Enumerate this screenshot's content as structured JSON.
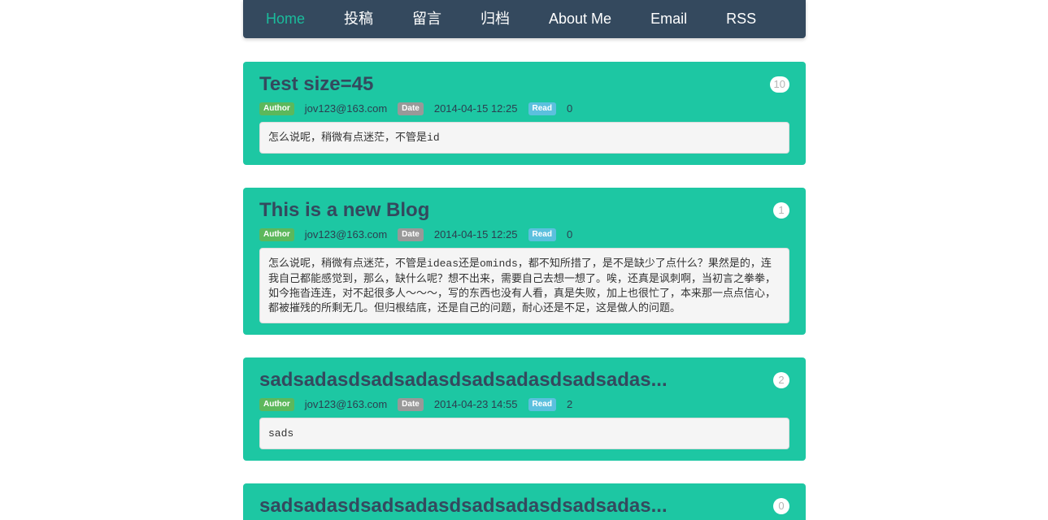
{
  "nav": {
    "items": [
      {
        "label": "Home",
        "active": true
      },
      {
        "label": "投稿"
      },
      {
        "label": "留言"
      },
      {
        "label": "归档"
      },
      {
        "label": "About Me"
      },
      {
        "label": "Email"
      },
      {
        "label": "RSS"
      }
    ]
  },
  "labels": {
    "author": "Author",
    "date": "Date",
    "read": "Read"
  },
  "posts": [
    {
      "title": "Test size=45",
      "comments": "10",
      "author": "jov123@163.com",
      "date": "2014-04-15 12:25",
      "read": "0",
      "content": [
        {
          "text": "怎么说呢，稍微有点迷茫，不管是"
        },
        {
          "code": "id"
        }
      ]
    },
    {
      "title": "This is a new Blog",
      "comments": "1",
      "author": "jov123@163.com",
      "date": "2014-04-15 12:25",
      "read": "0",
      "content": [
        {
          "text": "怎么说呢，稍微有点迷茫，不管是"
        },
        {
          "code": "ideas"
        },
        {
          "text": "还是"
        },
        {
          "code": "ominds"
        },
        {
          "text": "，都不知所措了，是不是缺少了点什么？果然是的，连我自己都能感觉到，那么，缺什么呢？想不出来，需要自己去想一想了。唉，还真是讽刺啊，当初言之拳拳，如今拖沓连连，对不起很多人～～～，写的东西也没有人看，真是失败，加上也很忙了，本来那一点点信心，都被摧残的所剩无几。但归根结底，还是自己的问题，耐心还是不足，这是做人的问题。"
        }
      ]
    },
    {
      "title": "sadsadasdsadsadasdsadsadasdsadsadas...",
      "comments": "2",
      "author": "jov123@163.com",
      "date": "2014-04-23 14:55",
      "read": "2",
      "content": [
        {
          "code": "sads"
        }
      ]
    },
    {
      "title": "sadsadasdsadsadasdsadsadasdsadsadas...",
      "comments": "0"
    }
  ]
}
